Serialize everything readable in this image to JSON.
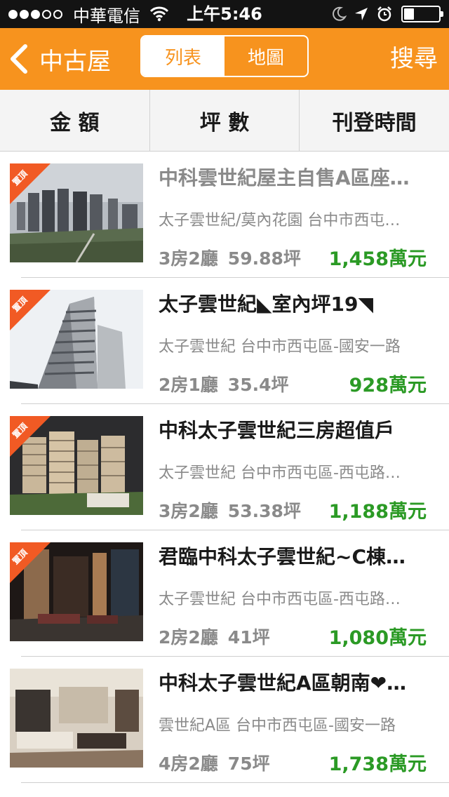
{
  "status_bar": {
    "signal_dots_filled": 3,
    "signal_dots_total": 5,
    "carrier": "中華電信",
    "time": "上午5:46",
    "icons": [
      "wifi-icon",
      "moon-icon",
      "location-icon",
      "alarm-icon",
      "battery-icon"
    ],
    "battery_level": 0.3
  },
  "nav": {
    "back_label": "中古屋",
    "segment_list": "列表",
    "segment_map": "地圖",
    "search_label": "搜尋",
    "accent_color": "#f7931e"
  },
  "filters": {
    "amount": "金 額",
    "area": "坪 數",
    "date": "刊登時間"
  },
  "ribbon_label": "置頂",
  "listings": [
    {
      "title": "中科雲世紀屋主自售A區座…",
      "subtitle": "太子雲世紀/莫內花園 台中市西屯…",
      "rooms": "3房2廳",
      "area": "59.88坪",
      "price": "1,458萬元",
      "pinned": true,
      "image": "city-skyline"
    },
    {
      "title": "太子雲世紀◣室內坪19◥",
      "subtitle": "太子雲世紀 台中市西屯區-國安一路",
      "rooms": "2房1廳",
      "area": "35.4坪",
      "price": "928萬元",
      "pinned": true,
      "image": "tower"
    },
    {
      "title": "中科太子雲世紀三房超值戶",
      "subtitle": "太子雲世紀 台中市西屯區-西屯路…",
      "rooms": "3房2廳",
      "area": "53.38坪",
      "price": "1,188萬元",
      "pinned": true,
      "image": "model"
    },
    {
      "title": "君臨中科太子雲世紀~C棟…",
      "subtitle": "太子雲世紀 台中市西屯區-西屯路…",
      "rooms": "2房2廳",
      "area": "41坪",
      "price": "1,080萬元",
      "pinned": true,
      "image": "lobby"
    },
    {
      "title": "中科太子雲世紀A區朝南❤…",
      "subtitle": "雲世紀A區 台中市西屯區-國安一路",
      "rooms": "4房2廳",
      "area": "75坪",
      "price": "1,738萬元",
      "pinned": false,
      "image": "living-room"
    }
  ],
  "colors": {
    "price": "#2b9a25",
    "ribbon": "#f15a24"
  }
}
